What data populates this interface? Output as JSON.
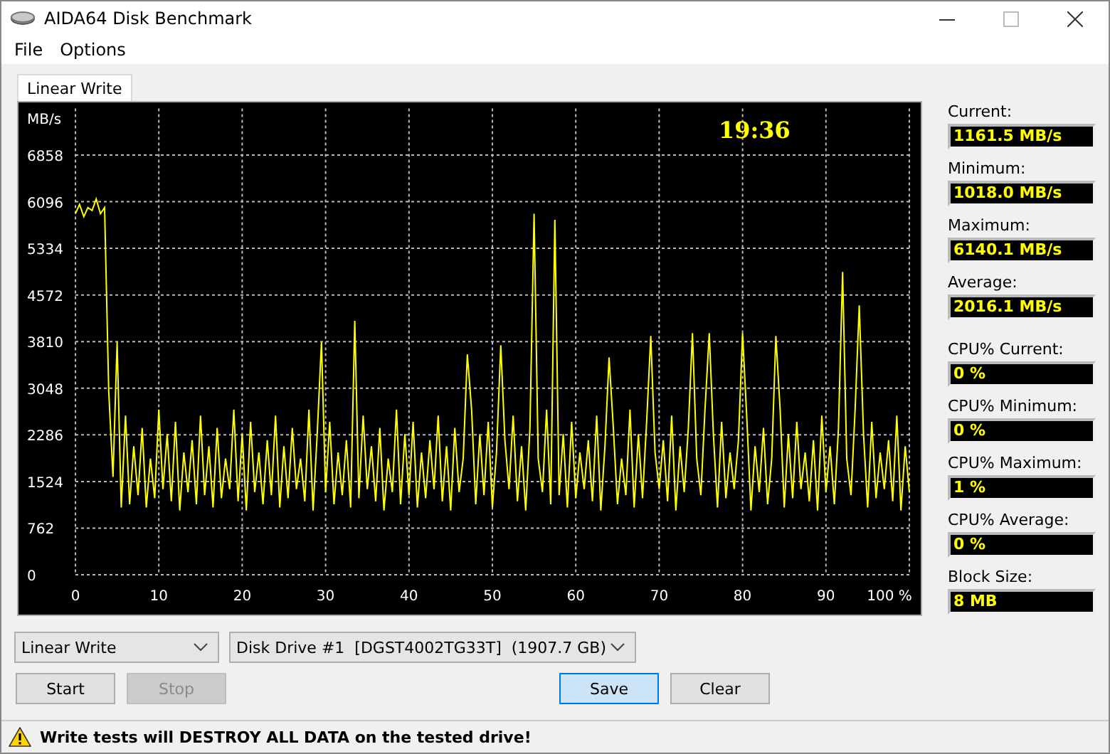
{
  "window": {
    "title": "AIDA64 Disk Benchmark"
  },
  "menu": [
    "File",
    "Options"
  ],
  "tabs": [
    {
      "label": "Linear Write",
      "selected": true
    }
  ],
  "graph": {
    "clock": "19:36",
    "chart_data": {
      "type": "line",
      "ylabel": "MB/s",
      "xlim": [
        0,
        100
      ],
      "ylim": [
        0,
        7620
      ],
      "grid": true,
      "xticks": [
        0,
        10,
        20,
        30,
        40,
        50,
        60,
        70,
        80,
        90,
        {
          "value": 100,
          "label": "100 %"
        }
      ],
      "yticks": [
        0,
        762,
        1524,
        2286,
        3048,
        3810,
        4572,
        5334,
        6096,
        6858
      ],
      "x": [
        0,
        0.5,
        1,
        1.5,
        2,
        2.5,
        3,
        3.5,
        4,
        4.5,
        5,
        5.5,
        6,
        6.5,
        7,
        7.5,
        8,
        8.5,
        9,
        9.5,
        10,
        10.5,
        11,
        11.5,
        12,
        12.5,
        13,
        13.5,
        14,
        14.5,
        15,
        15.5,
        16,
        16.5,
        17,
        17.5,
        18,
        18.5,
        19,
        19.5,
        20,
        20.5,
        21,
        21.5,
        22,
        22.5,
        23,
        23.5,
        24,
        24.5,
        25,
        25.5,
        26,
        26.5,
        27,
        27.5,
        28,
        28.5,
        29,
        29.5,
        30,
        30.5,
        31,
        31.5,
        32,
        32.5,
        33,
        33.5,
        34,
        34.5,
        35,
        35.5,
        36,
        36.5,
        37,
        37.5,
        38,
        38.5,
        39,
        39.5,
        40,
        40.5,
        41,
        41.5,
        42,
        42.5,
        43,
        43.5,
        44,
        44.5,
        45,
        45.5,
        46,
        46.5,
        47,
        47.5,
        48,
        48.5,
        49,
        49.5,
        50,
        50.5,
        51,
        51.5,
        52,
        52.5,
        53,
        53.5,
        54,
        54.5,
        55,
        55.5,
        56,
        56.5,
        57,
        57.5,
        58,
        58.5,
        59,
        59.5,
        60,
        60.5,
        61,
        61.5,
        62,
        62.5,
        63,
        63.5,
        64,
        64.5,
        65,
        65.5,
        66,
        66.5,
        67,
        67.5,
        68,
        68.5,
        69,
        69.5,
        70,
        70.5,
        71,
        71.5,
        72,
        72.5,
        73,
        73.5,
        74,
        74.5,
        75,
        75.5,
        76,
        76.5,
        77,
        77.5,
        78,
        78.5,
        79,
        79.5,
        80,
        80.5,
        81,
        81.5,
        82,
        82.5,
        83,
        83.5,
        84,
        84.5,
        85,
        85.5,
        86,
        86.5,
        87,
        87.5,
        88,
        88.5,
        89,
        89.5,
        90,
        90.5,
        91,
        91.5,
        92,
        92.5,
        93,
        93.5,
        94,
        94.5,
        95,
        95.5,
        96,
        96.5,
        97,
        97.5,
        98,
        98.5,
        99,
        99.5,
        100
      ],
      "series": [
        {
          "color": "#ffff00",
          "values": [
            5900,
            6050,
            5850,
            6000,
            5950,
            6140,
            5900,
            6000,
            3000,
            1600,
            3800,
            1100,
            2600,
            1150,
            2100,
            1300,
            2400,
            1100,
            1900,
            1250,
            2700,
            1400,
            2300,
            1200,
            2500,
            1050,
            2000,
            1350,
            2200,
            1150,
            2600,
            1300,
            2100,
            1100,
            2400,
            1250,
            1900,
            1400,
            2700,
            1200,
            2300,
            1050,
            2500,
            1350,
            2000,
            1150,
            2200,
            1300,
            2600,
            1100,
            2100,
            1250,
            2400,
            1400,
            1900,
            1200,
            2700,
            1050,
            2300,
            3800,
            1350,
            2500,
            1150,
            2000,
            1300,
            2200,
            1100,
            4150,
            1250,
            2600,
            1400,
            2100,
            1200,
            2400,
            1050,
            1900,
            1350,
            2700,
            1150,
            2300,
            1300,
            2500,
            1100,
            2000,
            1250,
            2200,
            1400,
            2600,
            1200,
            2100,
            1050,
            2400,
            1350,
            1900,
            3600,
            2700,
            1150,
            2300,
            1300,
            2500,
            1100,
            2000,
            3750,
            2200,
            1400,
            2600,
            1200,
            2100,
            1050,
            2400,
            5900,
            1900,
            1350,
            2700,
            1150,
            5800,
            1300,
            2300,
            1100,
            2500,
            1250,
            2000,
            1400,
            2200,
            1200,
            2600,
            1050,
            2100,
            3550,
            2400,
            1150,
            1900,
            1300,
            2700,
            1100,
            2300,
            1250,
            2500,
            3900,
            2000,
            1400,
            2200,
            1200,
            2600,
            1050,
            2100,
            1350,
            2400,
            3950,
            1900,
            1300,
            2700,
            3950,
            2300,
            1100,
            2500,
            1250,
            2000,
            1400,
            2200,
            3950,
            2600,
            1050,
            2100,
            1350,
            2400,
            1150,
            1900,
            3900,
            2700,
            1100,
            2300,
            1250,
            2500,
            1400,
            2000,
            1200,
            2200,
            1050,
            2600,
            1350,
            2100,
            1150,
            2400,
            4950,
            1900,
            1300,
            2700,
            4400,
            2300,
            1100,
            2500,
            1250,
            2000,
            1400,
            2200,
            1200,
            2600,
            1050,
            2100,
            1350
          ]
        }
      ]
    }
  },
  "throughput_stats": [
    {
      "label": "Current:",
      "value": "1161.5 MB/s"
    },
    {
      "label": "Minimum:",
      "value": "1018.0 MB/s"
    },
    {
      "label": "Maximum:",
      "value": "6140.1 MB/s"
    },
    {
      "label": "Average:",
      "value": "2016.1 MB/s"
    }
  ],
  "cpu_stats": [
    {
      "label": "CPU% Current:",
      "value": "0 %"
    },
    {
      "label": "CPU% Minimum:",
      "value": "0 %"
    },
    {
      "label": "CPU% Maximum:",
      "value": "1 %"
    },
    {
      "label": "CPU% Average:",
      "value": "0 %"
    },
    {
      "label": "Block Size:",
      "value": "8 MB"
    }
  ],
  "test_select": {
    "value": "Linear Write"
  },
  "drive_select": {
    "value": "Disk Drive #1  [DGST4002TG33T]  (1907.7 GB)"
  },
  "left_buttons": [
    {
      "label": "Start",
      "disabled": false,
      "default": false
    },
    {
      "label": "Stop",
      "disabled": true,
      "default": false
    }
  ],
  "right_buttons": [
    {
      "label": "Save",
      "disabled": false,
      "default": true
    },
    {
      "label": "Clear",
      "disabled": false,
      "default": false
    }
  ],
  "status_bar": {
    "warning": "Write tests will DESTROY ALL DATA on the tested drive!"
  }
}
